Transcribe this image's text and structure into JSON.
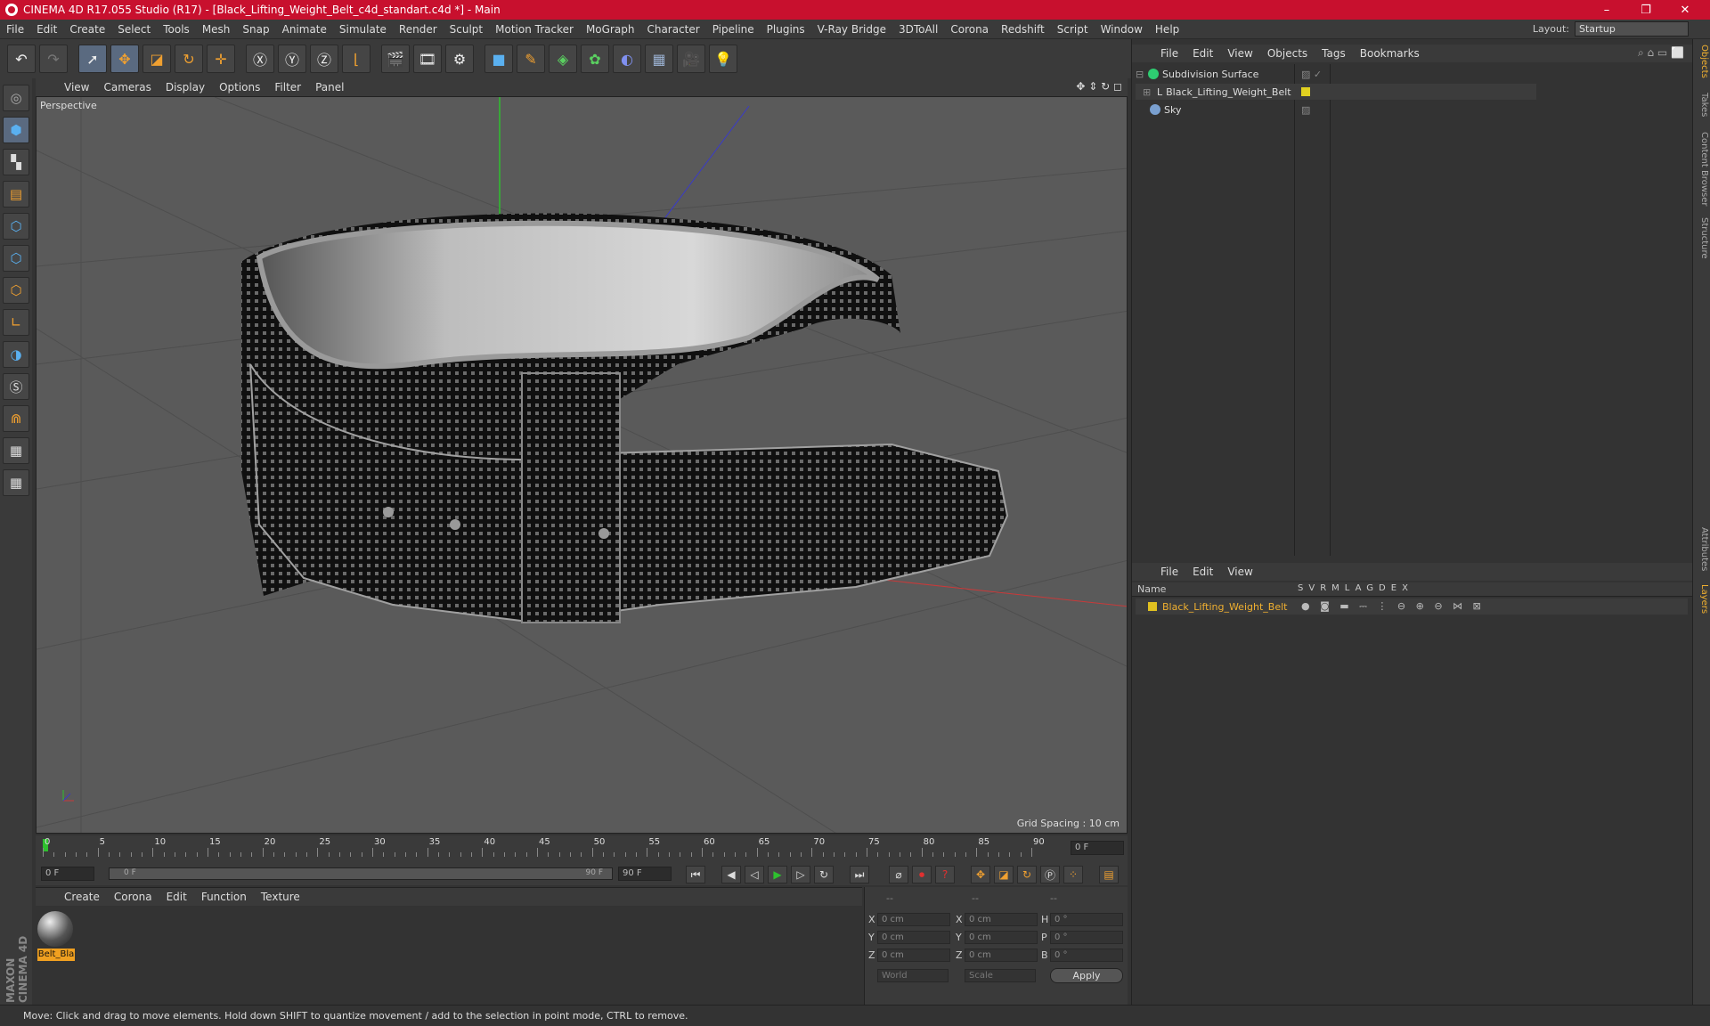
{
  "window": {
    "title": "CINEMA 4D R17.055 Studio (R17) - [Black_Lifting_Weight_Belt_c4d_standart.c4d *] - Main",
    "min": "–",
    "max": "❐",
    "close": "✕"
  },
  "menu": [
    "File",
    "Edit",
    "Create",
    "Select",
    "Tools",
    "Mesh",
    "Snap",
    "Animate",
    "Simulate",
    "Render",
    "Sculpt",
    "Motion Tracker",
    "MoGraph",
    "Character",
    "Pipeline",
    "Plugins",
    "V-Ray Bridge",
    "3DToAll",
    "Corona",
    "Redshift",
    "Script",
    "Window",
    "Help"
  ],
  "layout": {
    "label": "Layout:",
    "value": "Startup"
  },
  "viewport": {
    "menu": [
      "View",
      "Cameras",
      "Display",
      "Options",
      "Filter",
      "Panel"
    ],
    "label": "Perspective",
    "grid_spacing": "Grid Spacing : 10 cm"
  },
  "timeline": {
    "ticks": [
      "0",
      "5",
      "10",
      "15",
      "20",
      "25",
      "30",
      "35",
      "40",
      "45",
      "50",
      "55",
      "60",
      "65",
      "70",
      "75",
      "80",
      "85",
      "90"
    ],
    "current_frame": "0 F",
    "start": "0 F",
    "range_start": "0 F",
    "range_end": "90 F",
    "end": "90 F"
  },
  "materials": {
    "menu": [
      "Create",
      "Corona",
      "Edit",
      "Function",
      "Texture"
    ],
    "items": [
      {
        "name": "Belt_Bla"
      }
    ]
  },
  "coords": {
    "headers": [
      "--",
      "--",
      "--"
    ],
    "rows": [
      {
        "a": "X",
        "av": "0 cm",
        "b": "X",
        "bv": "0 cm",
        "c": "H",
        "cv": "0 °"
      },
      {
        "a": "Y",
        "av": "0 cm",
        "b": "Y",
        "bv": "0 cm",
        "c": "P",
        "cv": "0 °"
      },
      {
        "a": "Z",
        "av": "0 cm",
        "b": "Z",
        "bv": "0 cm",
        "c": "B",
        "cv": "0 °"
      }
    ],
    "world": "World",
    "scale": "Scale",
    "apply": "Apply"
  },
  "objects": {
    "menu": [
      "File",
      "Edit",
      "View",
      "Objects",
      "Tags",
      "Bookmarks"
    ],
    "items": [
      {
        "name": "Subdivision Surface",
        "color": "#2ecc71"
      },
      {
        "name": "Black_Lifting_Weight_Belt",
        "color": "#e0d020"
      },
      {
        "name": "Sky",
        "color": "#7aa0d0"
      }
    ]
  },
  "layers": {
    "menu": [
      "File",
      "Edit",
      "View"
    ],
    "col_name": "Name",
    "cols": [
      "S",
      "V",
      "R",
      "M",
      "L",
      "A",
      "G",
      "D",
      "E",
      "X"
    ],
    "items": [
      {
        "name": "Black_Lifting_Weight_Belt",
        "color": "#e0c020"
      }
    ]
  },
  "sidetabs": [
    "Objects",
    "Takes",
    "Content Browser",
    "Structure",
    "Attributes",
    "Layers"
  ],
  "status": "Move: Click and drag to move elements. Hold down SHIFT to quantize movement / add to the selection in point mode, CTRL to remove.",
  "brand": "MAXON CINEMA 4D"
}
